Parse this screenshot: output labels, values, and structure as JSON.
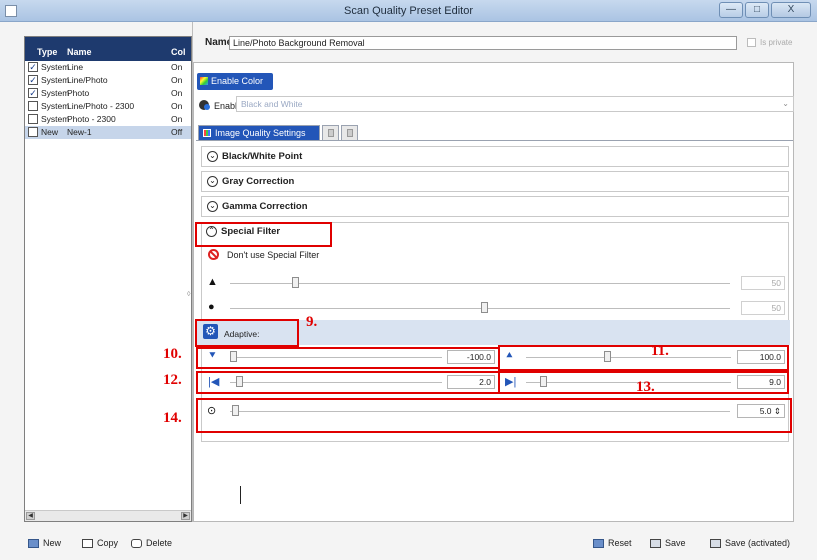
{
  "window": {
    "title": "Scan Quality Preset Editor",
    "min": "—",
    "max": "□",
    "close": "X"
  },
  "list": {
    "headers": {
      "type": "Type",
      "name": "Name",
      "col": "Col"
    },
    "rows": [
      {
        "checked": true,
        "type": "System",
        "name": "Line",
        "col": "On",
        "selected": false
      },
      {
        "checked": true,
        "type": "System",
        "name": "Line/Photo",
        "col": "On",
        "selected": false
      },
      {
        "checked": true,
        "type": "System",
        "name": "Photo",
        "col": "On",
        "selected": false
      },
      {
        "checked": false,
        "type": "System",
        "name": "Line/Photo - 2300",
        "col": "On",
        "selected": false
      },
      {
        "checked": false,
        "type": "System",
        "name": "Photo - 2300",
        "col": "On",
        "selected": false
      },
      {
        "checked": false,
        "type": "New",
        "name": "New-1",
        "col": "Off",
        "selected": true
      }
    ]
  },
  "form": {
    "name_label": "Name:",
    "name_value": "Line/Photo Background Removal",
    "private_label": "Is private",
    "enable_color_label": "Enable Color",
    "enable_label": "Enable",
    "enable_value": "Black and White",
    "tab_label": "Image Quality Settings",
    "sections": {
      "bw": "Black/White Point",
      "gray": "Gray Correction",
      "gamma": "Gamma Correction",
      "special": "Special Filter"
    },
    "no_special": "Don't use Special Filter",
    "slider1_value": "50",
    "slider2_value": "50",
    "adaptive_label": "Adaptive:",
    "s10_value": "-100.0",
    "s11_value": "100.0",
    "s12_value": "2.0",
    "s13_value": "9.0",
    "s14_value": "5.0"
  },
  "annotations": {
    "a9": "9.",
    "a10": "10.",
    "a11": "11.",
    "a12": "12.",
    "a13": "13.",
    "a14": "14."
  },
  "footer": {
    "new": "New",
    "copy": "Copy",
    "delete": "Delete",
    "reset": "Reset",
    "save": "Save",
    "save_activated": "Save (activated)"
  }
}
